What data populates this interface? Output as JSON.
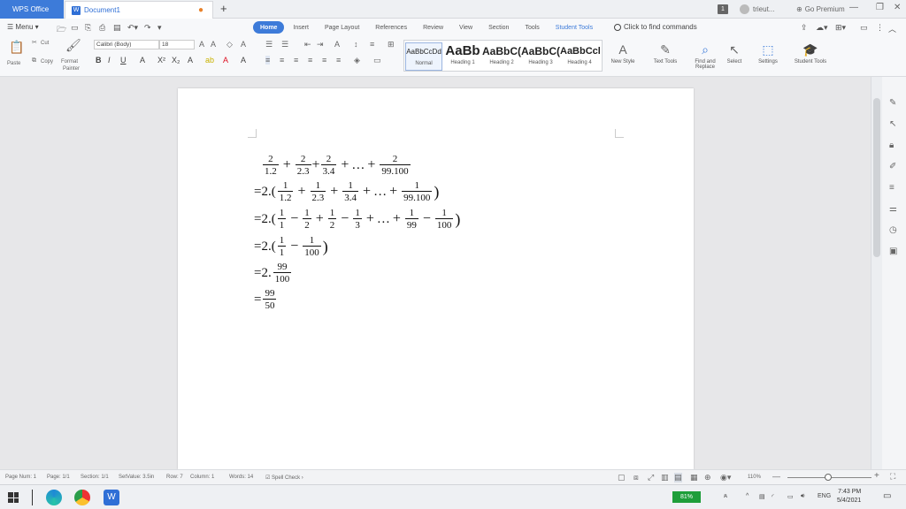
{
  "titlebar": {
    "app_tab": "WPS Office",
    "doc_tab": "Document1",
    "doc_icon": "W",
    "unsaved_dot": "●",
    "new_tab": "+",
    "badge": "1",
    "user": "trieut...",
    "premium": "Go Premium"
  },
  "ribbon": {
    "menu": "Menu",
    "tabs": [
      "Home",
      "Insert",
      "Page Layout",
      "References",
      "Review",
      "View",
      "Section",
      "Tools",
      "Student Tools"
    ],
    "find_commands": "Click to find commands",
    "clipboard": {
      "paste": "Paste",
      "cut": "Cut",
      "copy": "Copy",
      "format_painter_1": "Format",
      "format_painter_2": "Painter"
    },
    "font_name": "Calibri (Body)",
    "font_size": "18",
    "styles": [
      {
        "preview": "AaBbCcDd",
        "name": "Normal"
      },
      {
        "preview": "AaBb",
        "name": "Heading 1"
      },
      {
        "preview": "AaBbC(",
        "name": "Heading 2"
      },
      {
        "preview": "AaBbC(",
        "name": "Heading 3"
      },
      {
        "preview": "AaBbCcl",
        "name": "Heading 4"
      }
    ],
    "new_style": "New Style",
    "text_tools": "Text Tools",
    "find_replace_1": "Find and",
    "find_replace_2": "Replace",
    "select": "Select",
    "settings": "Settings",
    "student_tools": "Student Tools"
  },
  "document": {
    "line1": {
      "fracs": [
        [
          "2",
          "1.2"
        ],
        [
          "2",
          "2.3"
        ],
        [
          "2",
          "3.4"
        ]
      ],
      "dots": "…",
      "last": [
        "2",
        "99.100"
      ]
    },
    "line2": {
      "prefix": "=2.(",
      "fracs": [
        [
          "1",
          "1.2"
        ],
        [
          "1",
          "2.3"
        ],
        [
          "1",
          "3.4"
        ]
      ],
      "dots": "…",
      "last": [
        "1",
        "99.100"
      ],
      "suffix": ")"
    },
    "line3": {
      "prefix": "=2.(",
      "fracs": [
        [
          "1",
          "1"
        ],
        [
          "1",
          "2"
        ],
        [
          "1",
          "2"
        ],
        [
          "1",
          "3"
        ]
      ],
      "dots": "…",
      "last1": [
        "1",
        "99"
      ],
      "last2": [
        "1",
        "100"
      ],
      "suffix": ")"
    },
    "line4": {
      "prefix": "=2.(",
      "f1": [
        "1",
        "1"
      ],
      "f2": [
        "1",
        "100"
      ],
      "suffix": ")"
    },
    "line5": {
      "prefix": "=2.",
      "f1": [
        "99",
        "100"
      ]
    },
    "line6": {
      "prefix": "=",
      "f1": [
        "99",
        "50"
      ]
    }
  },
  "status": {
    "page_num": "Page Num: 1",
    "pages": "Page: 1/1",
    "section": "Section: 1/1",
    "set_value": "SetValue: 3.5in",
    "row": "Row: 7",
    "column": "Column: 1",
    "words": "Words: 14",
    "spell": "Spell Check",
    "zoom": "110%"
  },
  "taskbar": {
    "battery": "81%",
    "lang": "ENG",
    "time": "7:43 PM",
    "date": "5/4/2021"
  },
  "colors": {
    "accent": "#3d7bd9",
    "battery": "#1e9e3a"
  }
}
